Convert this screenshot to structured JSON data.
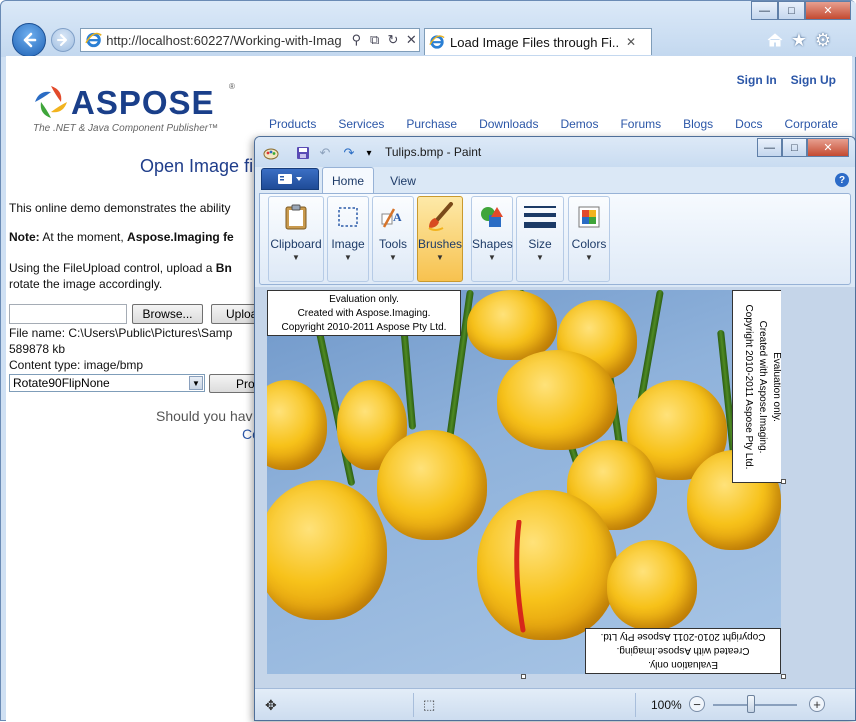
{
  "browser": {
    "address": "http://localhost:60227/Working-with-Imag",
    "tab_title": "Load Image Files through Fi...",
    "tab_close": "✕",
    "caption_buttons": [
      "—",
      "□",
      "✕"
    ],
    "toolbar_icons": [
      "home-icon",
      "star-icon",
      "gear-icon"
    ]
  },
  "webpage": {
    "logo_text": "ASPOSE",
    "logo_reg": "®",
    "logo_tagline": "The .NET & Java Component Publisher™",
    "sign_in": "Sign In",
    "sign_up": "Sign Up",
    "nav": [
      "Products",
      "Services",
      "Purchase",
      "Downloads",
      "Demos",
      "Forums",
      "Blogs",
      "Docs",
      "Corporate"
    ],
    "page_title": "Open Image fi",
    "intro_text": "This online demo demonstrates the ability",
    "note_label": "Note:",
    "note_text": " At the moment, ",
    "note_bold": "Aspose.Imaging fe",
    "upload_text_1": "Using the FileUpload control, upload a ",
    "upload_text_1_bold": "Bn",
    "upload_text_2": "rotate the image accordingly.",
    "browse_label": "Browse...",
    "upload_label": "Uploa",
    "file_name": "File name: C:\\Users\\Public\\Pictures\\Samp",
    "file_size": "589878 kb",
    "content_type": "Content type: image/bmp",
    "rotate_selected": "Rotate90FlipNone",
    "process_label": "Pro",
    "should_text": "Should you hav",
    "contact_text": "Co"
  },
  "paint": {
    "title": "Tulips.bmp - Paint",
    "caption_buttons": [
      "—",
      "□",
      "✕"
    ],
    "tabs": {
      "home": "Home",
      "view": "View"
    },
    "help": "?",
    "groups": [
      {
        "label": "Clipboard",
        "icon": "clipboard-icon"
      },
      {
        "label": "Image",
        "icon": "select-icon"
      },
      {
        "label": "Tools",
        "icon": "tools-icon"
      },
      {
        "label": "Brushes",
        "icon": "brush-icon"
      },
      {
        "label": "Shapes",
        "icon": "shapes-icon"
      },
      {
        "label": "Size",
        "icon": "size-icon"
      },
      {
        "label": "Colors",
        "icon": "colors-icon"
      }
    ],
    "selected_group": "Brushes",
    "watermark_line1": "Evaluation only.",
    "watermark_line2": "Created with Aspose.Imaging.",
    "watermark_line3": "Copyright 2010-2011 Aspose Pty Ltd.",
    "zoom_level": "100%",
    "zoom_fraction": 0.45,
    "zoom_out": "−",
    "zoom_in": "+"
  },
  "colors": {
    "link_blue": "#2b56a7",
    "title_blue": "#1f3d8a",
    "brushes_selected": "#f7c24f",
    "tulip_yellow": "#f7c21a",
    "sky_blue": "#8fb2db"
  }
}
